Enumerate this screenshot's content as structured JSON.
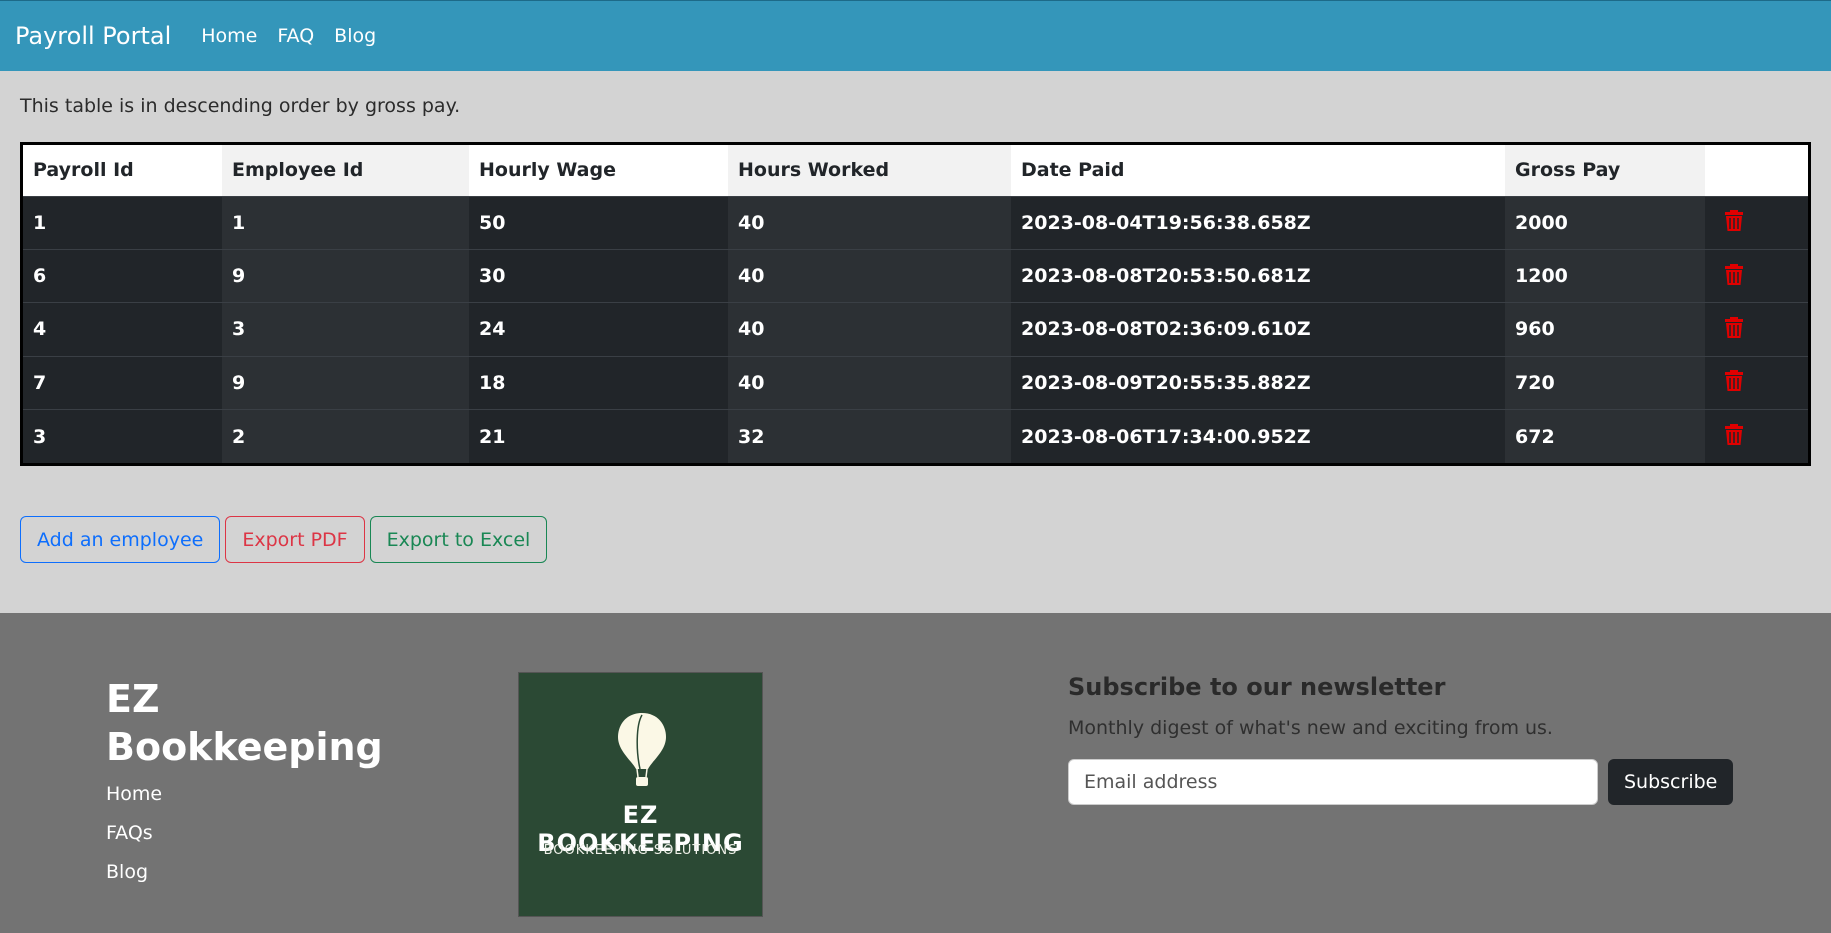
{
  "nav": {
    "brand": "Payroll Portal",
    "links": [
      "Home",
      "FAQ",
      "Blog"
    ]
  },
  "intro": "This table is in descending order by gross pay.",
  "table": {
    "headers": [
      "Payroll Id",
      "Employee Id",
      "Hourly Wage",
      "Hours Worked",
      "Date Paid",
      "Gross Pay"
    ],
    "rows": [
      [
        "1",
        "1",
        "50",
        "40",
        "2023-08-04T19:56:38.658Z",
        "2000"
      ],
      [
        "6",
        "9",
        "30",
        "40",
        "2023-08-08T20:53:50.681Z",
        "1200"
      ],
      [
        "4",
        "3",
        "24",
        "40",
        "2023-08-08T02:36:09.610Z",
        "960"
      ],
      [
        "7",
        "9",
        "18",
        "40",
        "2023-08-09T20:55:35.882Z",
        "720"
      ],
      [
        "3",
        "2",
        "21",
        "32",
        "2023-08-06T17:34:00.952Z",
        "672"
      ]
    ],
    "action_icon": "trash-icon"
  },
  "buttons": {
    "add": "Add an employee",
    "pdf": "Export PDF",
    "excel": "Export to Excel"
  },
  "footer": {
    "brand": "EZ Bookkeeping",
    "links": [
      "Home",
      "FAQs",
      "Blog"
    ],
    "logo": {
      "title": "EZ BOOKKEEPING",
      "subtitle": "BOOKKEEPING SOLUTIONS"
    },
    "newsletter": {
      "title": "Subscribe to our newsletter",
      "subtitle": "Monthly digest of what's new and exciting from us.",
      "placeholder": "Email address",
      "button": "Subscribe"
    }
  },
  "colors": {
    "navbar": "#3496ba",
    "table_dark": "#212529",
    "trash": "#e00000",
    "footer": "#737373",
    "logo_bg": "#2b4934"
  }
}
